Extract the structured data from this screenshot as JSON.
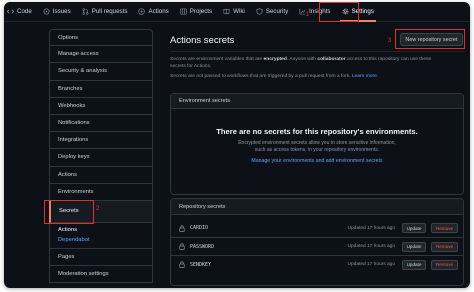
{
  "nav": {
    "items": [
      {
        "label": "Code",
        "icon": "code-icon"
      },
      {
        "label": "Issues",
        "icon": "issue-icon"
      },
      {
        "label": "Pull requests",
        "icon": "pull-request-icon"
      },
      {
        "label": "Actions",
        "icon": "play-icon"
      },
      {
        "label": "Projects",
        "icon": "table-icon"
      },
      {
        "label": "Wiki",
        "icon": "book-icon"
      },
      {
        "label": "Security",
        "icon": "shield-icon"
      },
      {
        "label": "Insights",
        "icon": "graph-icon"
      },
      {
        "label": "Settings",
        "icon": "gear-icon"
      }
    ],
    "active_index": 8
  },
  "annotations": {
    "step1": "1",
    "step2": "2",
    "step3": "3"
  },
  "sidebar": {
    "items": [
      "Options",
      "Manage access",
      "Security & analysis",
      "Branches",
      "Webhooks",
      "Notifications",
      "Integrations",
      "Deploy keys",
      "Actions",
      "Environments",
      "Secrets"
    ],
    "selected_index": 10,
    "sub_items": [
      "Actions",
      "Dependabot"
    ],
    "after_items": [
      "Pages",
      "Moderation settings"
    ]
  },
  "main": {
    "title": "Actions secrets",
    "new_button": "New repository secret",
    "desc1_a": "Secrets are environment variables that are ",
    "desc1_b": "encrypted",
    "desc1_c": ". Anyone with ",
    "desc1_d": "collaborator",
    "desc1_e": " access to this repository can use these",
    "desc1_f": "secrets for Actions.",
    "desc2_a": "Secrets are not passed to workflows that are triggered by a pull request from a fork. ",
    "desc2_link": "Learn more."
  },
  "env": {
    "header": "Environment secrets",
    "empty_title": "There are no secrets for this repository's environments.",
    "empty_body": "Encrypted environment secrets allow you to store sensitive information, such as access tokens, in your repository environments.",
    "manage_link": "Manage your environments and add environment secrets"
  },
  "repo": {
    "header": "Repository secrets",
    "secrets": [
      {
        "name": "CARDIO",
        "updated": "Updated 17 hours ago"
      },
      {
        "name": "PASSWORD",
        "updated": "Updated 17 hours ago"
      },
      {
        "name": "SENDKEY",
        "updated": "Updated 17 hours ago"
      }
    ],
    "update_label": "Update",
    "remove_label": "Remove"
  },
  "colors": {
    "accent": "#f78166",
    "link": "#58a6ff",
    "danger": "#f85149",
    "annotation": "#e03131",
    "background": "#0d1117"
  }
}
